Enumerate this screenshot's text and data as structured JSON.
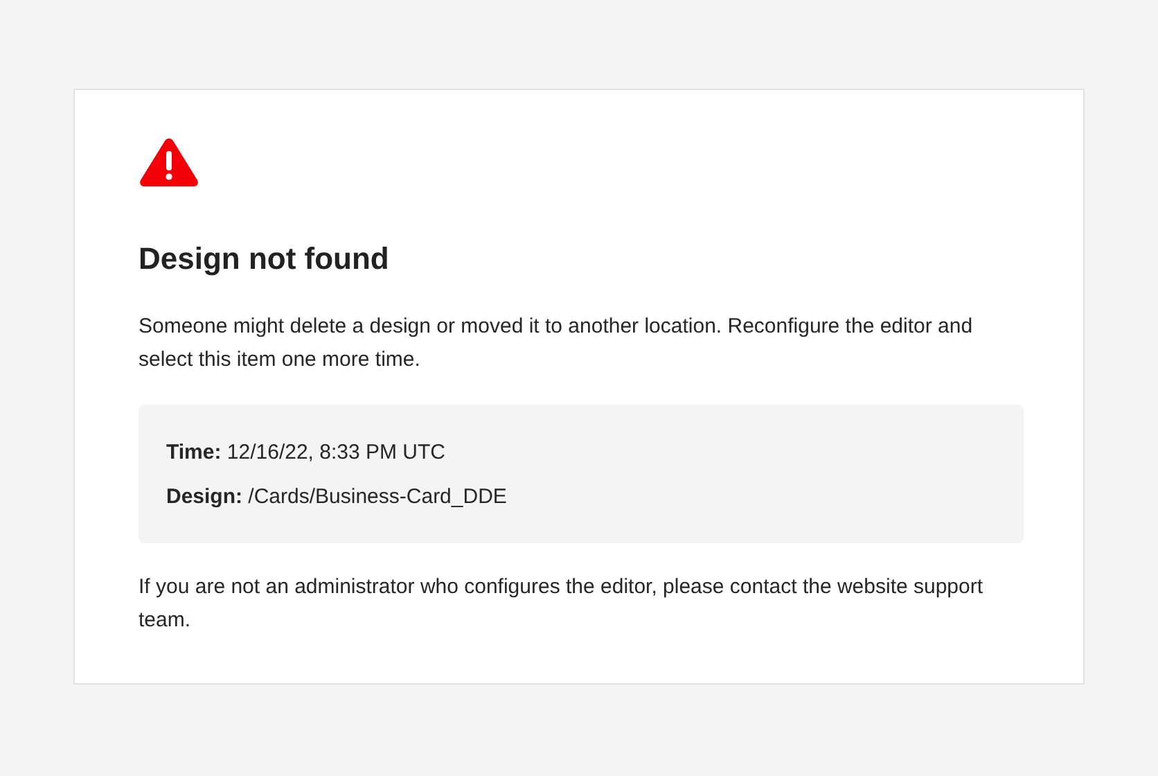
{
  "title": "Design not found",
  "message": "Someone might delete a design or moved it to another location. Reconfigure the editor and select this item one more time.",
  "details": [
    "**Time:** 12/16/22, 8:33 PM UTC",
    "**Design:** /Cards/Business-Card_DDE"
  ],
  "footer_note": "If you are not an administrator who configures the editor, please contact the website support team."
}
